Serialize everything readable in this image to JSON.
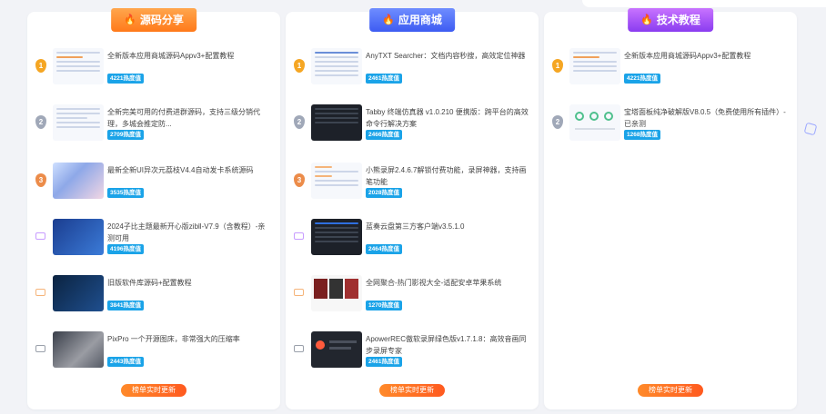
{
  "colors": {
    "heat_badge": "#1aa3e8",
    "update_button": "#ff6a1f",
    "ribbon_orange": "#ff8c2a",
    "ribbon_blue": "#4a68f5",
    "ribbon_purple": "#a24cf5"
  },
  "boards": [
    {
      "title": "源码分享",
      "footer": "榜单实时更新",
      "items": [
        {
          "rank": "1",
          "title": "全新版本应用商城源码Appv3+配置教程",
          "heat": "4221热度值"
        },
        {
          "rank": "2",
          "title": "全新完美可用的付费进群源码，支持三级分销代理，多城会推定防...",
          "heat": "2709热度值"
        },
        {
          "rank": "3",
          "title": "最新全新UI异次元荔枝V4.4自动发卡系统源码",
          "heat": "3535热度值"
        },
        {
          "rank": "4",
          "title": "2024子比主题最新开心版zibll-V7.9（含教程）-亲测可用",
          "heat": "4196热度值"
        },
        {
          "rank": "5",
          "title": "旧版软件库源码+配置教程",
          "heat": "3841热度值"
        },
        {
          "rank": "6",
          "title": "PixPro 一个开源图床，非常强大的压缩率",
          "heat": "2443热度值"
        }
      ]
    },
    {
      "title": "应用商城",
      "footer": "榜单实时更新",
      "items": [
        {
          "rank": "1",
          "title": "AnyTXT Searcher：文档内容秒搜，高效定位神器",
          "heat": "2461热度值"
        },
        {
          "rank": "2",
          "title": "Tabby 终端仿真器 v1.0.210 便携版：跨平台的高效命令行解决方案",
          "heat": "2466热度值"
        },
        {
          "rank": "3",
          "title": "小熊录屏2.4.6.7解锁付费功能，录屏神器，支持画笔功能",
          "heat": "2028热度值"
        },
        {
          "rank": "4",
          "title": "蓝奏云盘第三方客户端v3.5.1.0",
          "heat": "2464热度值"
        },
        {
          "rank": "5",
          "title": "全网聚合-热门影视大全-适配安卓苹果系统",
          "heat": "1270热度值"
        },
        {
          "rank": "6",
          "title": "ApowerREC傲软录屏绿色版v1.7.1.8：高效音画同步录屏专家",
          "heat": "2461热度值"
        }
      ]
    },
    {
      "title": "技术教程",
      "footer": "榜单实时更新",
      "items": [
        {
          "rank": "1",
          "title": "全新版本应用商城源码Appv3+配置教程",
          "heat": "4221热度值"
        },
        {
          "rank": "2",
          "title": "宝塔面板纯净破解版V8.0.5（免费使用所有插件）-已亲测",
          "heat": "1268热度值"
        }
      ]
    }
  ]
}
